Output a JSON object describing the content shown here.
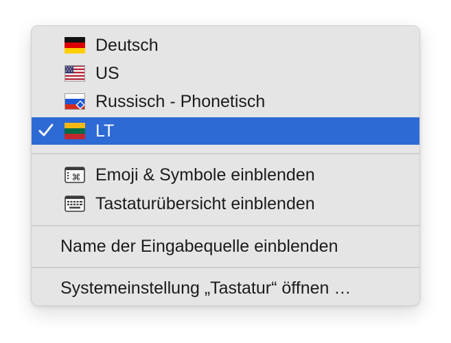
{
  "menu": {
    "input_sources": [
      {
        "label": "Deutsch",
        "flag": "flag-germany-icon",
        "checked": false
      },
      {
        "label": "US",
        "flag": "flag-usa-icon",
        "checked": false
      },
      {
        "label": "Russisch - Phonetisch",
        "flag": "flag-russia-phonetic-icon",
        "checked": false
      },
      {
        "label": "LT",
        "flag": "flag-lithuania-icon",
        "checked": true
      }
    ],
    "show_emoji": {
      "label": "Emoji & Symbole einblenden",
      "icon": "emoji-symbols-icon"
    },
    "show_keyboard_viewer": {
      "label": "Tastaturübersicht einblenden",
      "icon": "keyboard-icon"
    },
    "show_input_source_name": {
      "label": "Name der Eingabequelle einblenden"
    },
    "open_keyboard_prefs": {
      "label": "Systemeinstellung „Tastatur“ öffnen …"
    }
  },
  "colors": {
    "selection": "#2e6ad4",
    "menu_background": "#e5e5e5"
  }
}
